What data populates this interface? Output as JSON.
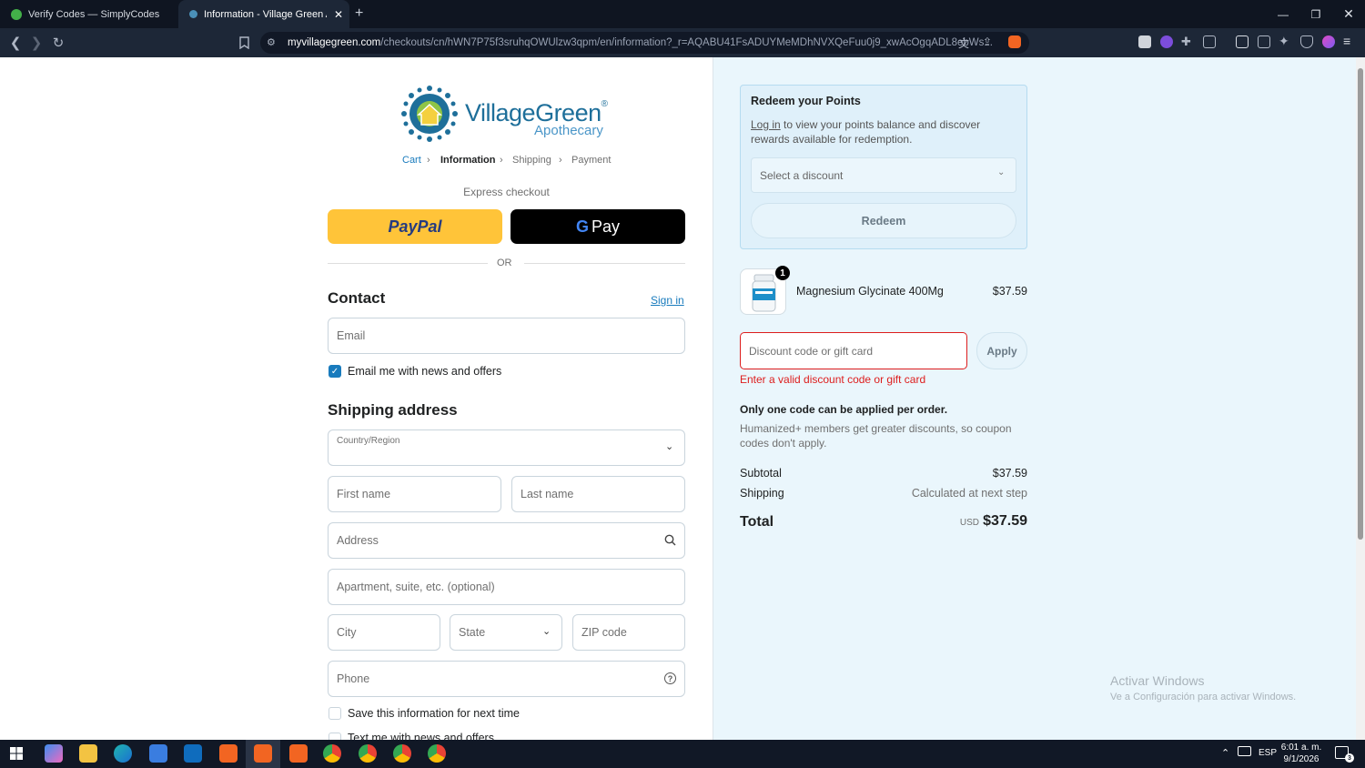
{
  "browser": {
    "tabs": [
      {
        "title": "Verify Codes — SimplyCodes"
      },
      {
        "title": "Information - Village Green Apot"
      }
    ],
    "new_tab": "+",
    "url_host": "myvillagegreen.com",
    "url_path": "/checkouts/cn/hWN7P75f3sruhqOWUlzw3qpm/en/information?_r=AQABU41FsADUYMeMDhNVXQeFuu0j9_xwAcOgqADL8ebWs..."
  },
  "checkout": {
    "logo": {
      "name": "VillageGreen",
      "reg": "®",
      "sub": "Apothecary"
    },
    "breadcrumb": [
      "Cart",
      "Information",
      "Shipping",
      "Payment"
    ],
    "express_label": "Express checkout",
    "paypal": "PayPal",
    "gpay": "Pay",
    "or": "OR",
    "contact": {
      "heading": "Contact",
      "sign_in": "Sign in",
      "email_placeholder": "Email",
      "news_label": "Email me with news and offers"
    },
    "shipping": {
      "heading": "Shipping address",
      "country_label": "Country/Region",
      "first_name": "First name",
      "last_name": "Last name",
      "address": "Address",
      "apartment": "Apartment, suite, etc. (optional)",
      "city": "City",
      "state": "State",
      "zip": "ZIP code",
      "phone": "Phone",
      "save_label": "Save this information for next time",
      "text_label": "Text me with news and offers"
    }
  },
  "summary": {
    "points": {
      "heading": "Redeem your Points",
      "login": "Log in",
      "desc": " to view your points balance and discover rewards available for redemption.",
      "select_placeholder": "Select a discount",
      "redeem": "Redeem"
    },
    "item": {
      "qty": "1",
      "name": "Magnesium Glycinate 400Mg",
      "price": "$37.59"
    },
    "discount": {
      "placeholder": "Discount code or gift card",
      "apply": "Apply",
      "error": "Enter a valid discount code or gift card"
    },
    "notice_bold": "Only one code can be applied per order.",
    "notice_text": "Humanized+ members get greater discounts, so coupon codes don't apply.",
    "subtotal_label": "Subtotal",
    "subtotal": "$37.59",
    "shipping_label": "Shipping",
    "shipping_value": "Calculated at next step",
    "total_label": "Total",
    "currency": "USD",
    "total": "$37.59"
  },
  "watermark": {
    "title": "Activar Windows",
    "sub": "Ve a Configuración para activar Windows."
  },
  "taskbar": {
    "lang": "ESP",
    "time": "6:01 a. m.",
    "date": "9/1/2026",
    "notif": "3"
  },
  "colors": {
    "accent": "#197bbd",
    "error": "#dd1d1d",
    "paypal": "#ffc439",
    "sidebar_bg": "#eaf6fc"
  }
}
